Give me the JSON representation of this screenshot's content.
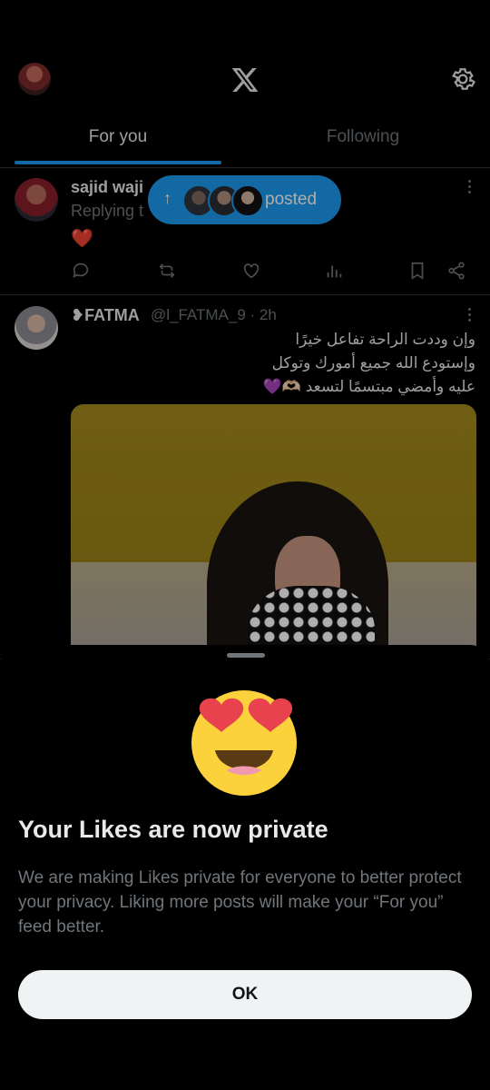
{
  "header": {
    "logo_text": "𝕏",
    "tabs": [
      {
        "label": "For you",
        "active": true
      },
      {
        "label": "Following",
        "active": false
      }
    ]
  },
  "posted_pill": {
    "arrow": "↑",
    "label": "posted"
  },
  "tweets": [
    {
      "name": "sajid waji",
      "replying": "Replying t",
      "content_emoji": "❤️"
    },
    {
      "name": "❥FATMA",
      "handle": "@l_FATMA_9 · 2h",
      "lines": [
        "وإن وددت الراحة تفاعل خيرًا",
        "وإستودع الله جميع أمورك وتوكل",
        "عليه وأمضي مبتسمًا لتسعد 🫶🏻💜"
      ]
    }
  ],
  "sheet": {
    "title": "Your Likes are now private",
    "body": "We are making Likes private for everyone to better protect your privacy. Liking more posts will make your “For you” feed better.",
    "ok_label": "OK"
  },
  "colors": {
    "accent": "#1d9bf0",
    "background": "#000000",
    "text": "#e7e9ea",
    "muted": "#71767b",
    "button_bg": "#eff3f4"
  }
}
